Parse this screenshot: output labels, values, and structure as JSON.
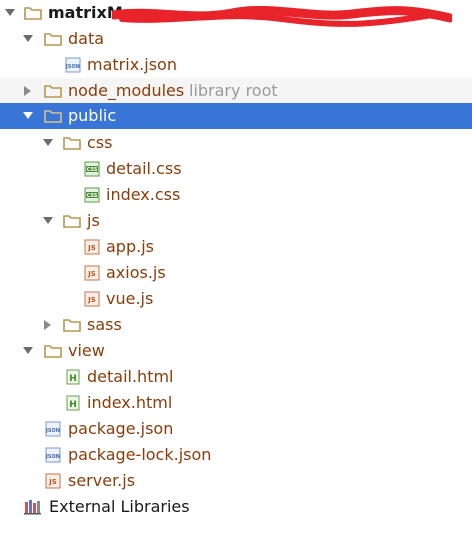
{
  "colors": {
    "selection": "#3875d6",
    "folder": "#c9a65a",
    "label_changed": "#8a3d0a",
    "hint": "#9a9a9a",
    "redaction": "#e8242a"
  },
  "tree": {
    "root": {
      "label": "matrixMe",
      "icon": "folder-icon"
    },
    "data": {
      "label": "data",
      "icon": "folder-icon"
    },
    "matrix_json": {
      "label": "matrix.json",
      "icon": "json-file-icon"
    },
    "node_modules": {
      "label": "node_modules",
      "hint": "library root",
      "icon": "folder-icon"
    },
    "public": {
      "label": "public",
      "icon": "folder-icon"
    },
    "css": {
      "label": "css",
      "icon": "folder-icon"
    },
    "detail_css": {
      "label": "detail.css",
      "icon": "css-file-icon"
    },
    "index_css": {
      "label": "index.css",
      "icon": "css-file-icon"
    },
    "js": {
      "label": "js",
      "icon": "folder-icon"
    },
    "app_js": {
      "label": "app.js",
      "icon": "js-file-icon"
    },
    "axios_js": {
      "label": "axios.js",
      "icon": "js-file-icon"
    },
    "vue_js": {
      "label": "vue.js",
      "icon": "js-file-icon"
    },
    "sass": {
      "label": "sass",
      "icon": "folder-icon"
    },
    "view": {
      "label": "view",
      "icon": "folder-icon"
    },
    "detail_html": {
      "label": "detail.html",
      "icon": "html-file-icon"
    },
    "index_html": {
      "label": "index.html",
      "icon": "html-file-icon"
    },
    "package_json": {
      "label": "package.json",
      "icon": "json-file-icon"
    },
    "package_lock_json": {
      "label": "package-lock.json",
      "icon": "json-file-icon"
    },
    "server_js": {
      "label": "server.js",
      "icon": "js-file-icon"
    },
    "external_libraries": {
      "label": "External Libraries",
      "icon": "external-libraries-icon"
    }
  },
  "file_icon_badges": {
    "json": "JSON",
    "css": "CSS",
    "js": "JS",
    "html": "H"
  }
}
